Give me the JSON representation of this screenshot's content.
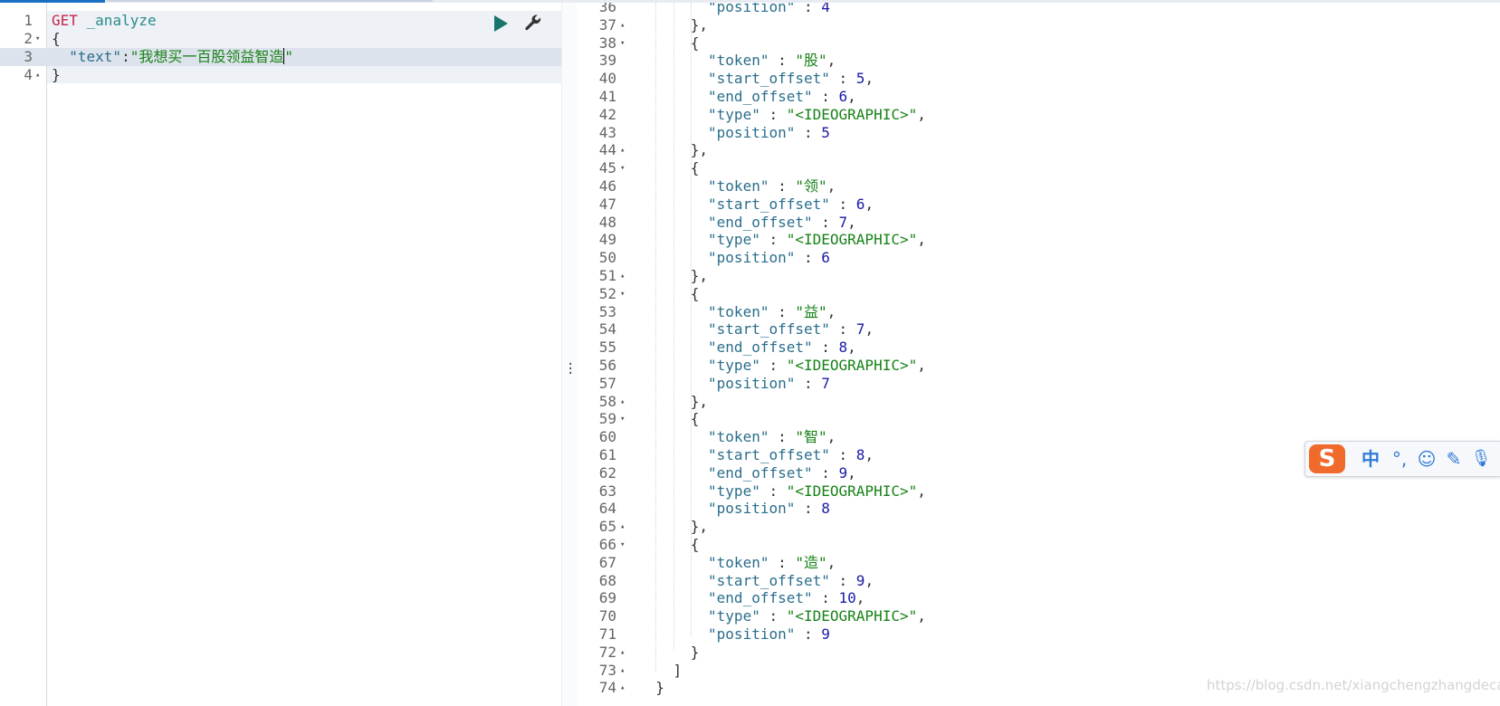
{
  "request_editor": {
    "lines": [
      {
        "num": "1",
        "fold": "",
        "tokens": [
          {
            "t": "GET",
            "c": "c-method"
          },
          {
            "t": " _analyze",
            "c": "c-url"
          }
        ]
      },
      {
        "num": "2",
        "fold": "▾",
        "tokens": [
          {
            "t": "{",
            "c": "c-brace"
          }
        ]
      },
      {
        "num": "3",
        "fold": "",
        "tokens": [
          {
            "t": "  ",
            "c": ""
          },
          {
            "t": "\"text\"",
            "c": "c-key"
          },
          {
            "t": ":",
            "c": "c-brace"
          },
          {
            "t": "\"我想买一百股领益智造",
            "c": "c-str"
          },
          {
            "t": "|cursor|",
            "c": "cursor"
          },
          {
            "t": "\"",
            "c": "c-str"
          }
        ]
      },
      {
        "num": "4",
        "fold": "▴",
        "tokens": [
          {
            "t": "}",
            "c": "c-brace"
          }
        ]
      }
    ],
    "actions": {
      "run": "play-icon",
      "settings": "wrench-icon"
    }
  },
  "response_editor": {
    "lines": [
      {
        "num": "36",
        "fold": "",
        "indent": 8,
        "tokens": [
          {
            "t": "\"position\"",
            "c": "c-key"
          },
          {
            "t": " : ",
            "c": "c-brace"
          },
          {
            "t": "4",
            "c": "c-num"
          }
        ]
      },
      {
        "num": "37",
        "fold": "▴",
        "indent": 6,
        "tokens": [
          {
            "t": "},",
            "c": "c-brace"
          }
        ]
      },
      {
        "num": "38",
        "fold": "▾",
        "indent": 6,
        "tokens": [
          {
            "t": "{",
            "c": "c-brace"
          }
        ]
      },
      {
        "num": "39",
        "fold": "",
        "indent": 8,
        "tokens": [
          {
            "t": "\"token\"",
            "c": "c-key"
          },
          {
            "t": " : ",
            "c": "c-brace"
          },
          {
            "t": "\"股\"",
            "c": "c-str"
          },
          {
            "t": ",",
            "c": "c-brace"
          }
        ]
      },
      {
        "num": "40",
        "fold": "",
        "indent": 8,
        "tokens": [
          {
            "t": "\"start_offset\"",
            "c": "c-key"
          },
          {
            "t": " : ",
            "c": "c-brace"
          },
          {
            "t": "5",
            "c": "c-num"
          },
          {
            "t": ",",
            "c": "c-brace"
          }
        ]
      },
      {
        "num": "41",
        "fold": "",
        "indent": 8,
        "tokens": [
          {
            "t": "\"end_offset\"",
            "c": "c-key"
          },
          {
            "t": " : ",
            "c": "c-brace"
          },
          {
            "t": "6",
            "c": "c-num"
          },
          {
            "t": ",",
            "c": "c-brace"
          }
        ]
      },
      {
        "num": "42",
        "fold": "",
        "indent": 8,
        "tokens": [
          {
            "t": "\"type\"",
            "c": "c-key"
          },
          {
            "t": " : ",
            "c": "c-brace"
          },
          {
            "t": "\"<IDEOGRAPHIC>\"",
            "c": "c-str"
          },
          {
            "t": ",",
            "c": "c-brace"
          }
        ]
      },
      {
        "num": "43",
        "fold": "",
        "indent": 8,
        "tokens": [
          {
            "t": "\"position\"",
            "c": "c-key"
          },
          {
            "t": " : ",
            "c": "c-brace"
          },
          {
            "t": "5",
            "c": "c-num"
          }
        ]
      },
      {
        "num": "44",
        "fold": "▴",
        "indent": 6,
        "tokens": [
          {
            "t": "},",
            "c": "c-brace"
          }
        ]
      },
      {
        "num": "45",
        "fold": "▾",
        "indent": 6,
        "tokens": [
          {
            "t": "{",
            "c": "c-brace"
          }
        ]
      },
      {
        "num": "46",
        "fold": "",
        "indent": 8,
        "tokens": [
          {
            "t": "\"token\"",
            "c": "c-key"
          },
          {
            "t": " : ",
            "c": "c-brace"
          },
          {
            "t": "\"领\"",
            "c": "c-str"
          },
          {
            "t": ",",
            "c": "c-brace"
          }
        ]
      },
      {
        "num": "47",
        "fold": "",
        "indent": 8,
        "tokens": [
          {
            "t": "\"start_offset\"",
            "c": "c-key"
          },
          {
            "t": " : ",
            "c": "c-brace"
          },
          {
            "t": "6",
            "c": "c-num"
          },
          {
            "t": ",",
            "c": "c-brace"
          }
        ]
      },
      {
        "num": "48",
        "fold": "",
        "indent": 8,
        "tokens": [
          {
            "t": "\"end_offset\"",
            "c": "c-key"
          },
          {
            "t": " : ",
            "c": "c-brace"
          },
          {
            "t": "7",
            "c": "c-num"
          },
          {
            "t": ",",
            "c": "c-brace"
          }
        ]
      },
      {
        "num": "49",
        "fold": "",
        "indent": 8,
        "tokens": [
          {
            "t": "\"type\"",
            "c": "c-key"
          },
          {
            "t": " : ",
            "c": "c-brace"
          },
          {
            "t": "\"<IDEOGRAPHIC>\"",
            "c": "c-str"
          },
          {
            "t": ",",
            "c": "c-brace"
          }
        ]
      },
      {
        "num": "50",
        "fold": "",
        "indent": 8,
        "tokens": [
          {
            "t": "\"position\"",
            "c": "c-key"
          },
          {
            "t": " : ",
            "c": "c-brace"
          },
          {
            "t": "6",
            "c": "c-num"
          }
        ]
      },
      {
        "num": "51",
        "fold": "▴",
        "indent": 6,
        "tokens": [
          {
            "t": "},",
            "c": "c-brace"
          }
        ]
      },
      {
        "num": "52",
        "fold": "▾",
        "indent": 6,
        "tokens": [
          {
            "t": "{",
            "c": "c-brace"
          }
        ]
      },
      {
        "num": "53",
        "fold": "",
        "indent": 8,
        "tokens": [
          {
            "t": "\"token\"",
            "c": "c-key"
          },
          {
            "t": " : ",
            "c": "c-brace"
          },
          {
            "t": "\"益\"",
            "c": "c-str"
          },
          {
            "t": ",",
            "c": "c-brace"
          }
        ]
      },
      {
        "num": "54",
        "fold": "",
        "indent": 8,
        "tokens": [
          {
            "t": "\"start_offset\"",
            "c": "c-key"
          },
          {
            "t": " : ",
            "c": "c-brace"
          },
          {
            "t": "7",
            "c": "c-num"
          },
          {
            "t": ",",
            "c": "c-brace"
          }
        ]
      },
      {
        "num": "55",
        "fold": "",
        "indent": 8,
        "tokens": [
          {
            "t": "\"end_offset\"",
            "c": "c-key"
          },
          {
            "t": " : ",
            "c": "c-brace"
          },
          {
            "t": "8",
            "c": "c-num"
          },
          {
            "t": ",",
            "c": "c-brace"
          }
        ]
      },
      {
        "num": "56",
        "fold": "",
        "indent": 8,
        "tokens": [
          {
            "t": "\"type\"",
            "c": "c-key"
          },
          {
            "t": " : ",
            "c": "c-brace"
          },
          {
            "t": "\"<IDEOGRAPHIC>\"",
            "c": "c-str"
          },
          {
            "t": ",",
            "c": "c-brace"
          }
        ]
      },
      {
        "num": "57",
        "fold": "",
        "indent": 8,
        "tokens": [
          {
            "t": "\"position\"",
            "c": "c-key"
          },
          {
            "t": " : ",
            "c": "c-brace"
          },
          {
            "t": "7",
            "c": "c-num"
          }
        ]
      },
      {
        "num": "58",
        "fold": "▴",
        "indent": 6,
        "tokens": [
          {
            "t": "},",
            "c": "c-brace"
          }
        ]
      },
      {
        "num": "59",
        "fold": "▾",
        "indent": 6,
        "tokens": [
          {
            "t": "{",
            "c": "c-brace"
          }
        ]
      },
      {
        "num": "60",
        "fold": "",
        "indent": 8,
        "tokens": [
          {
            "t": "\"token\"",
            "c": "c-key"
          },
          {
            "t": " : ",
            "c": "c-brace"
          },
          {
            "t": "\"智\"",
            "c": "c-str"
          },
          {
            "t": ",",
            "c": "c-brace"
          }
        ]
      },
      {
        "num": "61",
        "fold": "",
        "indent": 8,
        "tokens": [
          {
            "t": "\"start_offset\"",
            "c": "c-key"
          },
          {
            "t": " : ",
            "c": "c-brace"
          },
          {
            "t": "8",
            "c": "c-num"
          },
          {
            "t": ",",
            "c": "c-brace"
          }
        ]
      },
      {
        "num": "62",
        "fold": "",
        "indent": 8,
        "tokens": [
          {
            "t": "\"end_offset\"",
            "c": "c-key"
          },
          {
            "t": " : ",
            "c": "c-brace"
          },
          {
            "t": "9",
            "c": "c-num"
          },
          {
            "t": ",",
            "c": "c-brace"
          }
        ]
      },
      {
        "num": "63",
        "fold": "",
        "indent": 8,
        "tokens": [
          {
            "t": "\"type\"",
            "c": "c-key"
          },
          {
            "t": " : ",
            "c": "c-brace"
          },
          {
            "t": "\"<IDEOGRAPHIC>\"",
            "c": "c-str"
          },
          {
            "t": ",",
            "c": "c-brace"
          }
        ]
      },
      {
        "num": "64",
        "fold": "",
        "indent": 8,
        "tokens": [
          {
            "t": "\"position\"",
            "c": "c-key"
          },
          {
            "t": " : ",
            "c": "c-brace"
          },
          {
            "t": "8",
            "c": "c-num"
          }
        ]
      },
      {
        "num": "65",
        "fold": "▴",
        "indent": 6,
        "tokens": [
          {
            "t": "},",
            "c": "c-brace"
          }
        ]
      },
      {
        "num": "66",
        "fold": "▾",
        "indent": 6,
        "tokens": [
          {
            "t": "{",
            "c": "c-brace"
          }
        ]
      },
      {
        "num": "67",
        "fold": "",
        "indent": 8,
        "tokens": [
          {
            "t": "\"token\"",
            "c": "c-key"
          },
          {
            "t": " : ",
            "c": "c-brace"
          },
          {
            "t": "\"造\"",
            "c": "c-str"
          },
          {
            "t": ",",
            "c": "c-brace"
          }
        ]
      },
      {
        "num": "68",
        "fold": "",
        "indent": 8,
        "tokens": [
          {
            "t": "\"start_offset\"",
            "c": "c-key"
          },
          {
            "t": " : ",
            "c": "c-brace"
          },
          {
            "t": "9",
            "c": "c-num"
          },
          {
            "t": ",",
            "c": "c-brace"
          }
        ]
      },
      {
        "num": "69",
        "fold": "",
        "indent": 8,
        "tokens": [
          {
            "t": "\"end_offset\"",
            "c": "c-key"
          },
          {
            "t": " : ",
            "c": "c-brace"
          },
          {
            "t": "10",
            "c": "c-num"
          },
          {
            "t": ",",
            "c": "c-brace"
          }
        ]
      },
      {
        "num": "70",
        "fold": "",
        "indent": 8,
        "tokens": [
          {
            "t": "\"type\"",
            "c": "c-key"
          },
          {
            "t": " : ",
            "c": "c-brace"
          },
          {
            "t": "\"<IDEOGRAPHIC>\"",
            "c": "c-str"
          },
          {
            "t": ",",
            "c": "c-brace"
          }
        ]
      },
      {
        "num": "71",
        "fold": "",
        "indent": 8,
        "tokens": [
          {
            "t": "\"position\"",
            "c": "c-key"
          },
          {
            "t": " : ",
            "c": "c-brace"
          },
          {
            "t": "9",
            "c": "c-num"
          }
        ]
      },
      {
        "num": "72",
        "fold": "▴",
        "indent": 6,
        "tokens": [
          {
            "t": "}",
            "c": "c-brace"
          }
        ]
      },
      {
        "num": "73",
        "fold": "▴",
        "indent": 4,
        "tokens": [
          {
            "t": "]",
            "c": "c-brace"
          }
        ]
      },
      {
        "num": "74",
        "fold": "▴",
        "indent": 2,
        "tokens": [
          {
            "t": "}",
            "c": "c-brace"
          }
        ]
      }
    ]
  },
  "ime_toolbar": {
    "logo": "S",
    "buttons": [
      {
        "label": "中",
        "icon": "chinese-mode-icon"
      },
      {
        "label": "°,",
        "icon": "punctuation-icon"
      },
      {
        "label": "☺",
        "icon": "emoji-icon"
      },
      {
        "label": "✎",
        "icon": "pen-icon"
      },
      {
        "label": "🎙",
        "icon": "microphone-icon"
      }
    ]
  },
  "watermark": "https://blog.csdn.net/xiangchengzhangdecai",
  "colors": {
    "method": "#c7254e",
    "url": "#2b8b8b",
    "key": "#2a6e8c",
    "string": "#178217",
    "number": "#1a1aa6",
    "run_button": "#17756b",
    "ime_logo": "#f06a2c",
    "ime_icon": "#2f7bd6"
  }
}
